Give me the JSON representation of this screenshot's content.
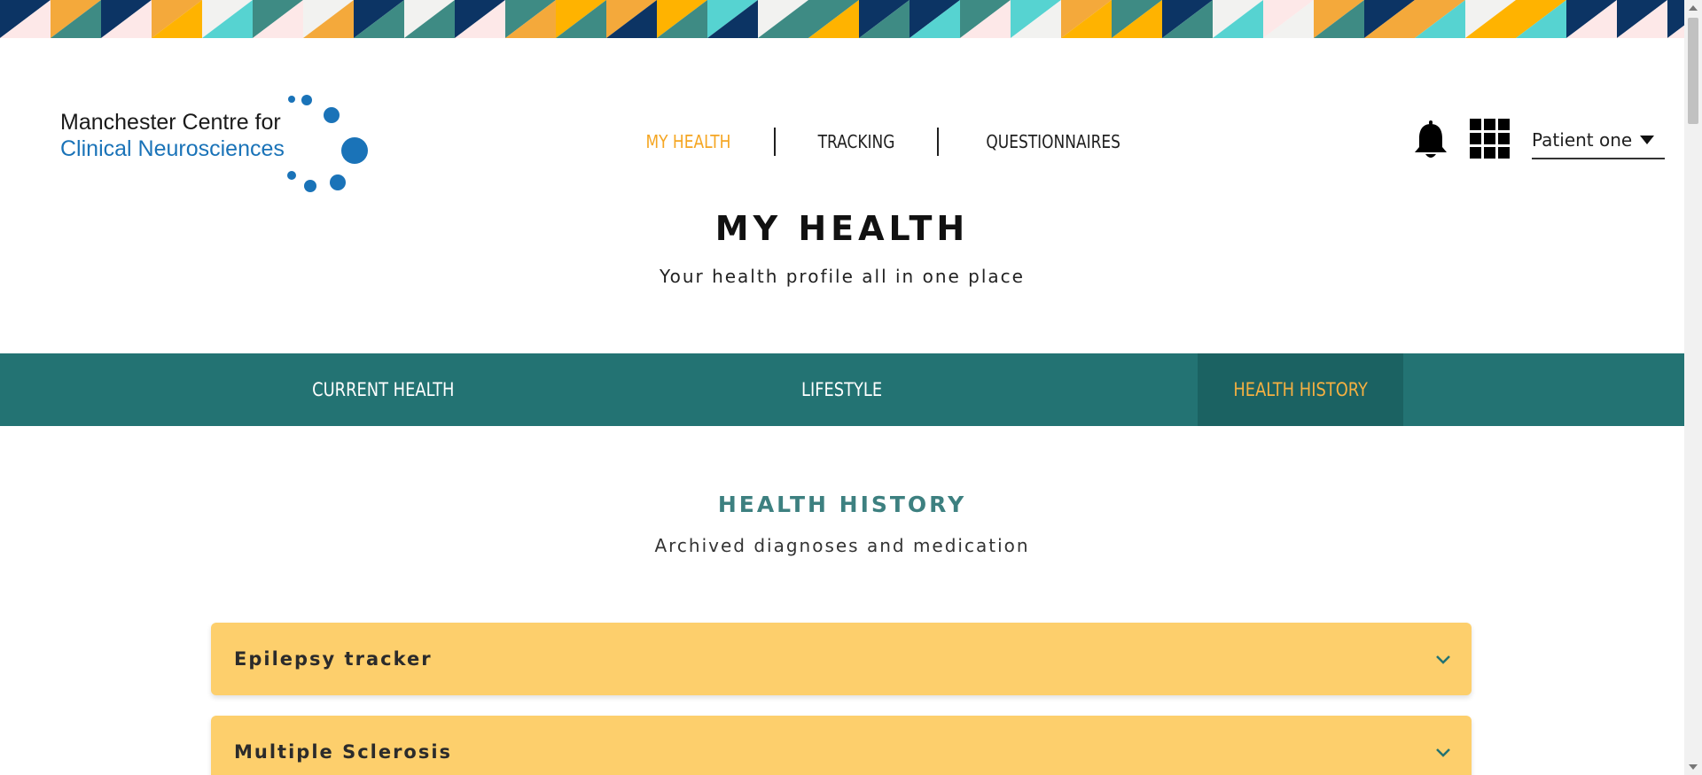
{
  "app": {
    "logo_line1": "Manchester Centre for",
    "logo_line2": "Clinical Neurosciences",
    "logo_color": "#1a73b8"
  },
  "nav": {
    "items": [
      {
        "label": "MY HEALTH",
        "active": true
      },
      {
        "label": "TRACKING",
        "active": false
      },
      {
        "label": "QUESTIONNAIRES",
        "active": false
      }
    ],
    "active_color": "#f5a623"
  },
  "header_icons": {
    "notifications": "bell-icon",
    "apps": "grid-icon"
  },
  "user": {
    "name": "Patient one"
  },
  "page": {
    "title": "MY HEALTH",
    "subtitle": "Your health profile all in one place"
  },
  "tabs": {
    "items": [
      {
        "label": "CURRENT HEALTH",
        "active": false
      },
      {
        "label": "LIFESTYLE",
        "active": false
      },
      {
        "label": "HEALTH HISTORY",
        "active": true
      }
    ],
    "bar_color": "#237373",
    "active_color": "#f5b041"
  },
  "section": {
    "title": "HEALTH HISTORY",
    "subtitle": "Archived diagnoses and medication"
  },
  "accordions": [
    {
      "title": "Epilepsy tracker",
      "icon": "chevron-down-icon"
    },
    {
      "title": "Multiple Sclerosis",
      "icon": "chevron-down-icon"
    }
  ],
  "colors": {
    "accordion_bg": "#fdcf6c",
    "section_title": "#3d8080",
    "banner_palette": [
      "#f4a93b",
      "#3e8b84",
      "#56d3d1",
      "#0c3464",
      "#f2f2f0",
      "#fde8e8",
      "#ffb300"
    ]
  }
}
